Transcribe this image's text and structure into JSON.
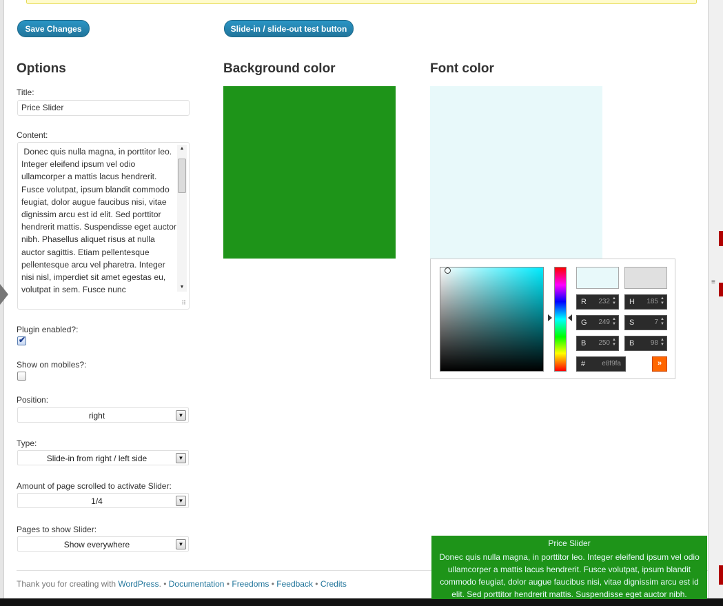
{
  "buttons": {
    "save": "Save Changes",
    "test": "Slide-in / slide-out test button"
  },
  "options": {
    "heading": "Options",
    "title_label": "Title:",
    "title_value": "Price Slider",
    "content_label": "Content:",
    "content_value": " Donec quis nulla magna, in porttitor leo. Integer eleifend ipsum vel odio ullamcorper a mattis lacus hendrerit. Fusce volutpat, ipsum blandit commodo feugiat, dolor augue faucibus nisi, vitae dignissim arcu est id elit. Sed porttitor hendrerit mattis. Suspendisse eget auctor nibh. Phasellus aliquet risus at nulla auctor sagittis. Etiam pellentesque pellentesque arcu vel pharetra. Integer nisi nisl, imperdiet sit amet egestas eu, volutpat in sem. Fusce nunc",
    "plugin_enabled_label": "Plugin enabled?:",
    "plugin_enabled": true,
    "show_mobiles_label": "Show on mobiles?:",
    "show_mobiles": false,
    "position_label": "Position:",
    "position_value": "right",
    "type_label": "Type:",
    "type_value": "Slide-in from right / left side",
    "scroll_label": "Amount of page scrolled to activate Slider:",
    "scroll_value": "1/4",
    "pages_label": "Pages to show Slider:",
    "pages_value": "Show everywhere"
  },
  "background": {
    "heading": "Background color",
    "color": "#1e9419"
  },
  "font": {
    "heading": "Font color",
    "color": "#e8f9fa"
  },
  "picker": {
    "new_color": "#e8f9fa",
    "current_color": "#e0e0e0",
    "r_label": "R",
    "r": "232",
    "g_label": "G",
    "g": "249",
    "b_label": "B",
    "b": "250",
    "h_label": "H",
    "h": "185",
    "s_label": "S",
    "s": "7",
    "bri_label": "B",
    "bri": "98",
    "hex_label": "#",
    "hex": "e8f9fa",
    "submit": "»"
  },
  "footer": {
    "prefix": "Thank you for creating with",
    "wordpress": "WordPress",
    "documentation": "Documentation",
    "freedoms": "Freedoms",
    "feedback": "Feedback",
    "credits": "Credits"
  },
  "preview": {
    "title": "Price Slider",
    "content": "Donec quis nulla magna, in porttitor leo. Integer eleifend ipsum vel odio ullamcorper a mattis lacus hendrerit. Fusce volutpat, ipsum blandit commodo feugiat, dolor augue faucibus nisi, vitae dignissim arcu est id elit. Sed porttitor hendrerit mattis. Suspendisse eget auctor nibh."
  },
  "icons": {
    "checkmark": "✔",
    "dropdown": "▼",
    "spin": "▲▼"
  }
}
